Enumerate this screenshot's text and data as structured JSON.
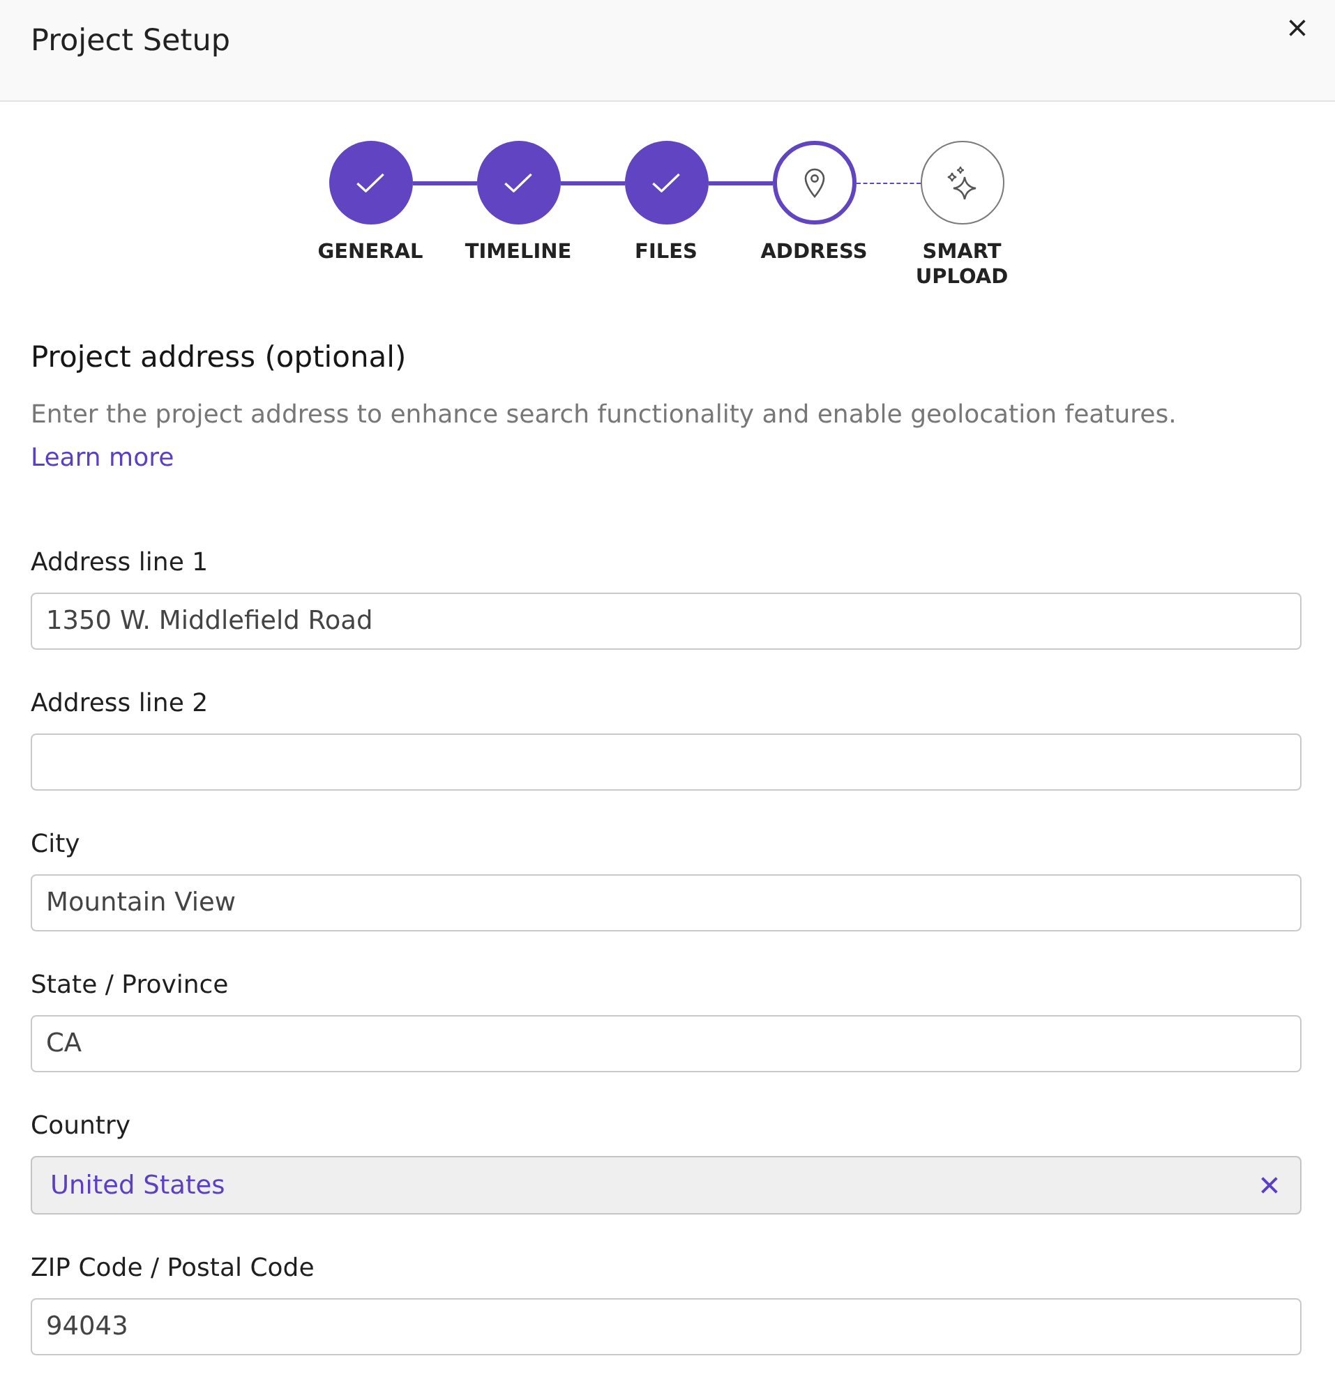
{
  "dialog": {
    "title": "Project Setup"
  },
  "steps": [
    {
      "label": "GENERAL",
      "completed": true,
      "selected": false
    },
    {
      "label": "TIMELINE",
      "completed": true,
      "selected": false
    },
    {
      "label": "FILES",
      "completed": true,
      "selected": false
    },
    {
      "label": "ADDRESS",
      "completed": false,
      "selected": true
    },
    {
      "label": "SMART UPLOAD",
      "completed": false,
      "selected": false
    }
  ],
  "section": {
    "heading": "Project address (optional)",
    "description": "Enter the project address to enhance search functionality and enable geolocation features.",
    "link": "Learn more"
  },
  "fields": [
    {
      "kind": "text",
      "label": "Address line 1",
      "value": "1350 W. Middlefield Road"
    },
    {
      "kind": "text",
      "label": "Address line 2"
    },
    {
      "kind": "text",
      "label": "City",
      "value": "Mountain View"
    },
    {
      "kind": "text",
      "label": "State / Province",
      "value": "CA"
    },
    {
      "kind": "select",
      "label": "Country",
      "value": "United States"
    },
    {
      "kind": "text",
      "label": "ZIP Code / Postal Code",
      "value": "94043"
    }
  ]
}
